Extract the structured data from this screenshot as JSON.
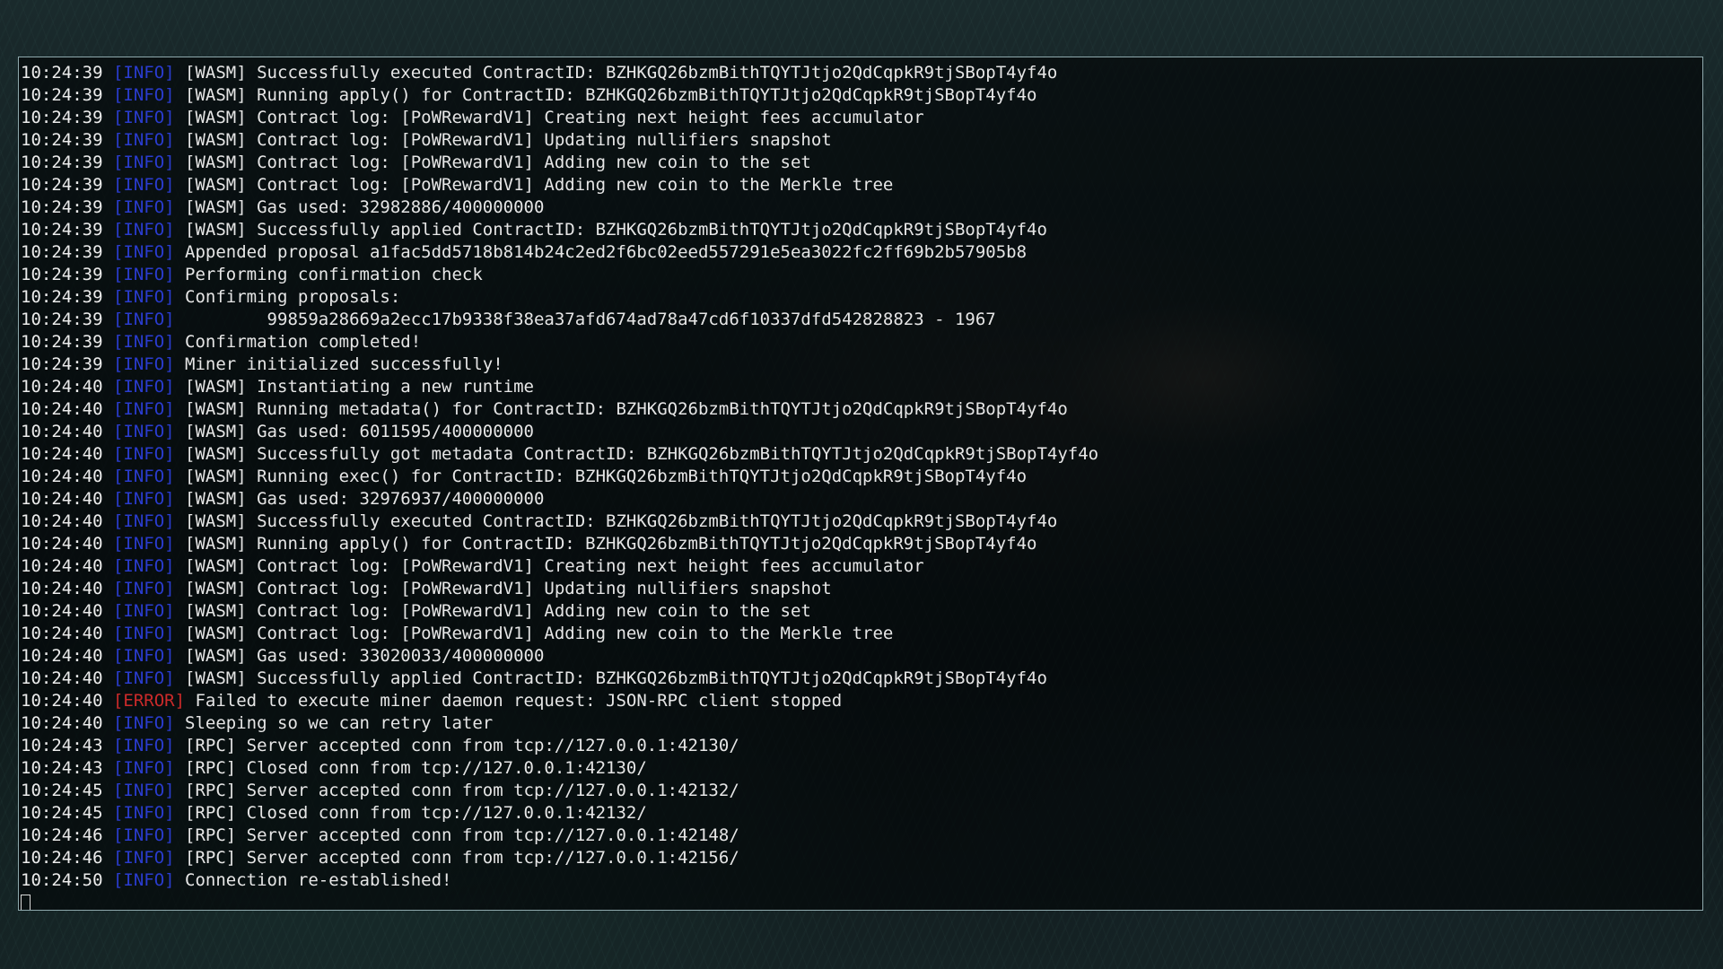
{
  "colors": {
    "info_level": "#2a3ccf",
    "error_level": "#cc2a2a",
    "text": "#e6e6e6",
    "window_border": "#8fa9ad"
  },
  "terminal": {
    "lines": [
      {
        "time": "10:24:39",
        "level": "[INFO]",
        "message": " [WASM] Successfully executed ContractID: BZHKGQ26bzmBithTQYTJtjo2QdCqpkR9tjSBopT4yf4o"
      },
      {
        "time": "10:24:39",
        "level": "[INFO]",
        "message": " [WASM] Running apply() for ContractID: BZHKGQ26bzmBithTQYTJtjo2QdCqpkR9tjSBopT4yf4o"
      },
      {
        "time": "10:24:39",
        "level": "[INFO]",
        "message": " [WASM] Contract log: [PoWRewardV1] Creating next height fees accumulator"
      },
      {
        "time": "10:24:39",
        "level": "[INFO]",
        "message": " [WASM] Contract log: [PoWRewardV1] Updating nullifiers snapshot"
      },
      {
        "time": "10:24:39",
        "level": "[INFO]",
        "message": " [WASM] Contract log: [PoWRewardV1] Adding new coin to the set"
      },
      {
        "time": "10:24:39",
        "level": "[INFO]",
        "message": " [WASM] Contract log: [PoWRewardV1] Adding new coin to the Merkle tree"
      },
      {
        "time": "10:24:39",
        "level": "[INFO]",
        "message": " [WASM] Gas used: 32982886/400000000"
      },
      {
        "time": "10:24:39",
        "level": "[INFO]",
        "message": " [WASM] Successfully applied ContractID: BZHKGQ26bzmBithTQYTJtjo2QdCqpkR9tjSBopT4yf4o"
      },
      {
        "time": "10:24:39",
        "level": "[INFO]",
        "message": " Appended proposal a1fac5dd5718b814b24c2ed2f6bc02eed557291e5ea3022fc2ff69b2b57905b8"
      },
      {
        "time": "10:24:39",
        "level": "[INFO]",
        "message": " Performing confirmation check"
      },
      {
        "time": "10:24:39",
        "level": "[INFO]",
        "message": " Confirming proposals:"
      },
      {
        "time": "10:24:39",
        "level": "[INFO]",
        "message": "         99859a28669a2ecc17b9338f38ea37afd674ad78a47cd6f10337dfd542828823 - 1967"
      },
      {
        "time": "10:24:39",
        "level": "[INFO]",
        "message": " Confirmation completed!"
      },
      {
        "time": "10:24:39",
        "level": "[INFO]",
        "message": " Miner initialized successfully!"
      },
      {
        "time": "10:24:40",
        "level": "[INFO]",
        "message": " [WASM] Instantiating a new runtime"
      },
      {
        "time": "10:24:40",
        "level": "[INFO]",
        "message": " [WASM] Running metadata() for ContractID: BZHKGQ26bzmBithTQYTJtjo2QdCqpkR9tjSBopT4yf4o"
      },
      {
        "time": "10:24:40",
        "level": "[INFO]",
        "message": " [WASM] Gas used: 6011595/400000000"
      },
      {
        "time": "10:24:40",
        "level": "[INFO]",
        "message": " [WASM] Successfully got metadata ContractID: BZHKGQ26bzmBithTQYTJtjo2QdCqpkR9tjSBopT4yf4o"
      },
      {
        "time": "10:24:40",
        "level": "[INFO]",
        "message": " [WASM] Running exec() for ContractID: BZHKGQ26bzmBithTQYTJtjo2QdCqpkR9tjSBopT4yf4o"
      },
      {
        "time": "10:24:40",
        "level": "[INFO]",
        "message": " [WASM] Gas used: 32976937/400000000"
      },
      {
        "time": "10:24:40",
        "level": "[INFO]",
        "message": " [WASM] Successfully executed ContractID: BZHKGQ26bzmBithTQYTJtjo2QdCqpkR9tjSBopT4yf4o"
      },
      {
        "time": "10:24:40",
        "level": "[INFO]",
        "message": " [WASM] Running apply() for ContractID: BZHKGQ26bzmBithTQYTJtjo2QdCqpkR9tjSBopT4yf4o"
      },
      {
        "time": "10:24:40",
        "level": "[INFO]",
        "message": " [WASM] Contract log: [PoWRewardV1] Creating next height fees accumulator"
      },
      {
        "time": "10:24:40",
        "level": "[INFO]",
        "message": " [WASM] Contract log: [PoWRewardV1] Updating nullifiers snapshot"
      },
      {
        "time": "10:24:40",
        "level": "[INFO]",
        "message": " [WASM] Contract log: [PoWRewardV1] Adding new coin to the set"
      },
      {
        "time": "10:24:40",
        "level": "[INFO]",
        "message": " [WASM] Contract log: [PoWRewardV1] Adding new coin to the Merkle tree"
      },
      {
        "time": "10:24:40",
        "level": "[INFO]",
        "message": " [WASM] Gas used: 33020033/400000000"
      },
      {
        "time": "10:24:40",
        "level": "[INFO]",
        "message": " [WASM] Successfully applied ContractID: BZHKGQ26bzmBithTQYTJtjo2QdCqpkR9tjSBopT4yf4o"
      },
      {
        "time": "10:24:40",
        "level": "[ERROR]",
        "message": " Failed to execute miner daemon request: JSON-RPC client stopped"
      },
      {
        "time": "10:24:40",
        "level": "[INFO]",
        "message": " Sleeping so we can retry later"
      },
      {
        "time": "10:24:43",
        "level": "[INFO]",
        "message": " [RPC] Server accepted conn from tcp://127.0.0.1:42130/"
      },
      {
        "time": "10:24:43",
        "level": "[INFO]",
        "message": " [RPC] Closed conn from tcp://127.0.0.1:42130/"
      },
      {
        "time": "10:24:45",
        "level": "[INFO]",
        "message": " [RPC] Server accepted conn from tcp://127.0.0.1:42132/"
      },
      {
        "time": "10:24:45",
        "level": "[INFO]",
        "message": " [RPC] Closed conn from tcp://127.0.0.1:42132/"
      },
      {
        "time": "10:24:46",
        "level": "[INFO]",
        "message": " [RPC] Server accepted conn from tcp://127.0.0.1:42148/"
      },
      {
        "time": "10:24:46",
        "level": "[INFO]",
        "message": " [RPC] Server accepted conn from tcp://127.0.0.1:42156/"
      },
      {
        "time": "10:24:50",
        "level": "[INFO]",
        "message": " Connection re-established!"
      }
    ]
  }
}
